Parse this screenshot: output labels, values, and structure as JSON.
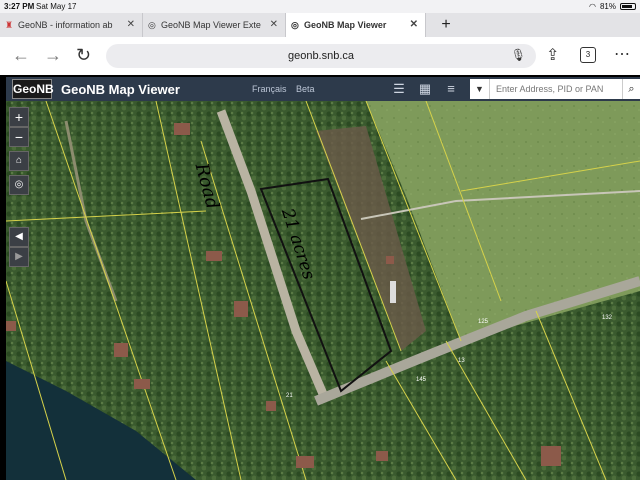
{
  "status": {
    "time": "3:27 PM",
    "date": "Sat May 17",
    "battery": "81%"
  },
  "tabs": [
    {
      "label": "GeoNB - information ab"
    },
    {
      "label": "GeoNB Map Viewer Exte"
    },
    {
      "label": "GeoNB Map Viewer"
    }
  ],
  "address": {
    "url": "geonb.snb.ca",
    "tab_count": "3"
  },
  "header": {
    "logo": "GeoNB",
    "title": "GeoNB Map Viewer",
    "lang_link": "Français",
    "beta_link": "Beta",
    "search_placeholder": "Enter Address, PID or PAN"
  },
  "map": {
    "road_labels": [
      "125",
      "132",
      "13",
      "21",
      "145"
    ],
    "handwriting": {
      "road": "Road",
      "area": "21 acres"
    }
  }
}
